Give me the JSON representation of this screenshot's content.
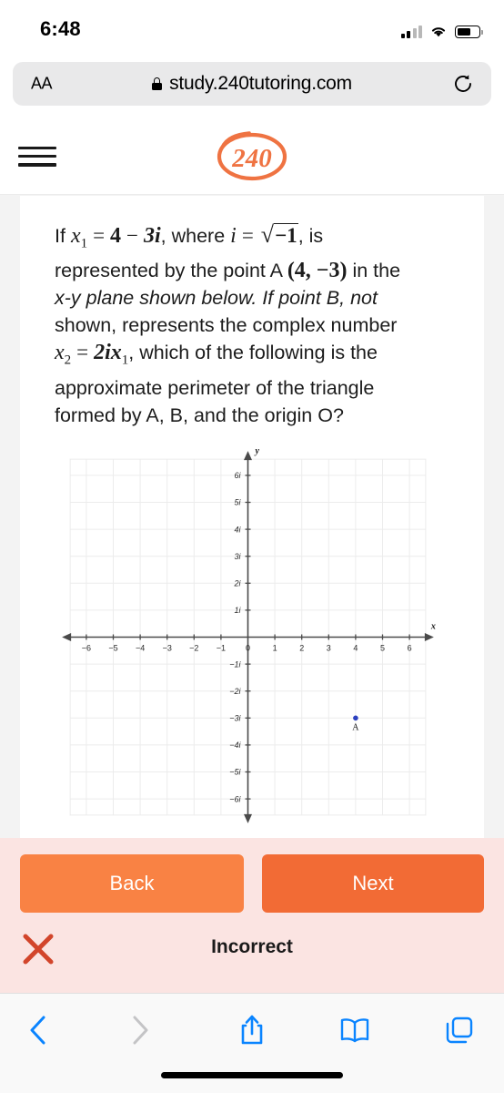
{
  "status_bar": {
    "time": "6:48",
    "signal_icon": "cellular-signal-icon",
    "wifi_icon": "wifi-icon",
    "battery_icon": "battery-icon",
    "battery_level_pct": 62
  },
  "browser": {
    "text_size_button": "AA",
    "lock_icon": "lock-icon",
    "url": "study.240tutoring.com",
    "reload_icon": "reload-icon",
    "toolbar": {
      "back_icon": "chevron-left-icon",
      "forward_icon": "chevron-right-icon",
      "share_icon": "share-icon",
      "bookmarks_icon": "book-icon",
      "tabs_icon": "tabs-icon"
    }
  },
  "site_header": {
    "menu_icon": "hamburger-menu-icon",
    "logo_text": "240",
    "logo_name": "240-tutoring-logo",
    "brand_color": "#ef7342"
  },
  "question": {
    "line1_prefix": "If",
    "var_x1": "x",
    "sub1": "1",
    "equals": "=",
    "value_4": "4",
    "minus": "−",
    "value_3i": "3i",
    "where": ", where",
    "var_i": "i",
    "equals2": "=",
    "sqrt_radicand": "−1",
    "line1_end": ", is",
    "line2": "represented by the point A",
    "point_a": "(4, −3)",
    "line2_end": "in the",
    "line3": "x-y plane shown below. If point B, not",
    "line4": "shown, represents the complex number",
    "var_x2": "x",
    "sub2": "2",
    "equals3": "=",
    "expr": "2ix",
    "sub3": "1",
    "line5_end": ", which of the following is the",
    "line6": "approximate perimeter of the triangle",
    "line7": "formed by A, B, and the origin O?"
  },
  "chart_data": {
    "type": "scatter",
    "title": "",
    "xlabel": "x",
    "ylabel": "y",
    "xlim": [
      -6.8,
      6.8
    ],
    "ylim": [
      -6.8,
      6.8
    ],
    "xticks": [
      -6,
      -5,
      -4,
      -3,
      -2,
      -1,
      0,
      1,
      2,
      3,
      4,
      5,
      6
    ],
    "xticklabels": [
      "−6",
      "−5",
      "−4",
      "−3",
      "−2",
      "−1",
      "0",
      "1",
      "2",
      "3",
      "4",
      "5",
      "6"
    ],
    "yticks": [
      6,
      5,
      4,
      3,
      2,
      1,
      -1,
      -2,
      -3,
      -4,
      -5,
      -6
    ],
    "yticklabels": [
      "6i",
      "5i",
      "4i",
      "3i",
      "2i",
      "1i",
      "−1i",
      "−2i",
      "−3i",
      "−4i",
      "−5i",
      "−6i"
    ],
    "grid": true,
    "grid_color": "#ececec",
    "axis_color": "#4a4a4a",
    "points": [
      {
        "label": "A",
        "x": 4,
        "y": -3,
        "color": "#2b3fbf"
      }
    ]
  },
  "answer_bar": {
    "back_label": "Back",
    "next_label": "Next",
    "result_icon": "x-mark-icon",
    "result_text": "Incorrect",
    "back_color": "#f98244",
    "next_color": "#f26b35",
    "bar_color": "#fbe4e2",
    "result_icon_color": "#d2452b"
  }
}
